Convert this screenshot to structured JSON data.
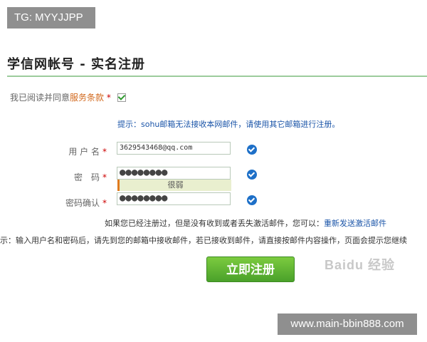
{
  "tag": "TG: MYYJJPP",
  "page_title": "学信网帐号 - 实名注册",
  "agree": {
    "prefix": "我已阅读并同意",
    "link": "服务条款",
    "required_mark": "*",
    "checked": true
  },
  "tip": "提示：sohu邮箱无法接收本网邮件，请使用其它邮箱进行注册。",
  "fields": {
    "username": {
      "label": "用 户 名",
      "required_mark": "*",
      "value": "3629543468@qq.com"
    },
    "password": {
      "label": "密　码",
      "required_mark": "*",
      "value": "●●●●●●●●"
    },
    "strength": "很弱",
    "confirm": {
      "label": "密码确认",
      "required_mark": "*",
      "value": "●●●●●●●●"
    }
  },
  "resend": {
    "prefix": "如果您已经注册过，但是没有收到或者丢失激活邮件，您可以：",
    "link": "重新发送激活邮件"
  },
  "hint": "示：输入用户名和密码后，请先到您的邮箱中接收邮件，若已接收到邮件，请直接按邮件内容操作，页面会提示您继续",
  "submit_label": "立即注册",
  "watermark": "Baidu 经验",
  "site": "www.main-bbin888.com",
  "colors": {
    "accent_green": "#4aa12a",
    "link_blue": "#1a54a8",
    "required_red": "#cc0000"
  }
}
